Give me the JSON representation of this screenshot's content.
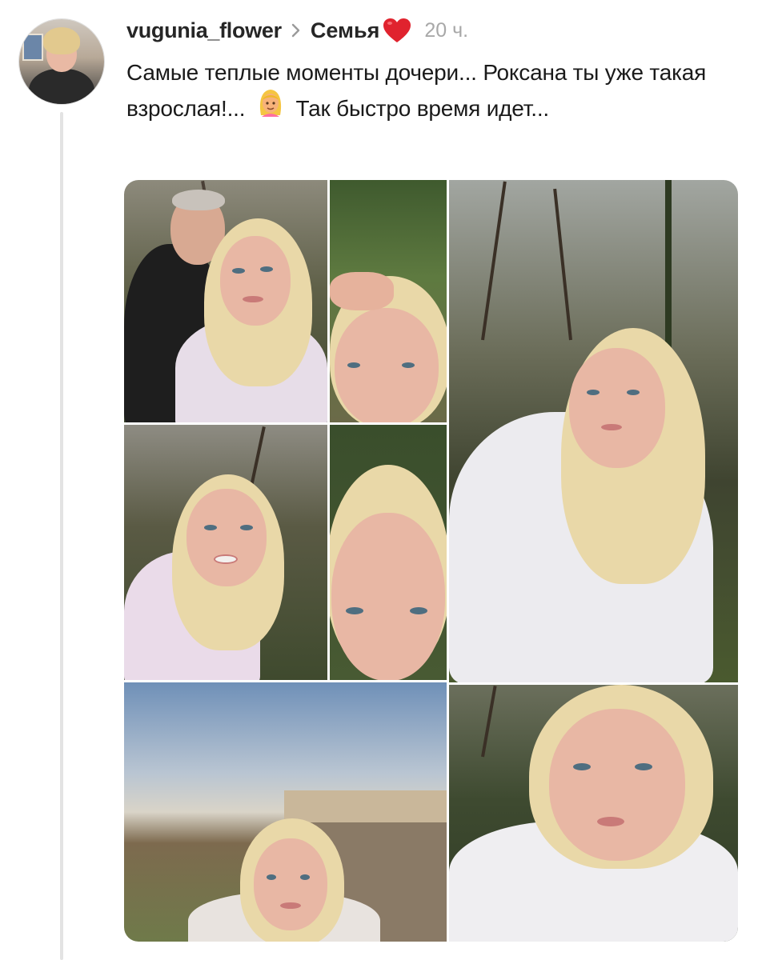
{
  "post": {
    "username": "vugunia_flower",
    "community": "Семья",
    "time": "20 ч.",
    "text_part1": "Самые теплые моменты дочери... Роксана ты уже такая взрослая!...",
    "text_part2": "Так быстро время идет..."
  },
  "icons": {
    "chevron": "chevron-right-icon",
    "community_badge": "red-heart-emoji",
    "inline_emoji": "blonde-woman-emoji"
  },
  "colors": {
    "heart": "#e0232e",
    "time": "#a8a8a8",
    "thread_line": "#e3e3e3"
  }
}
